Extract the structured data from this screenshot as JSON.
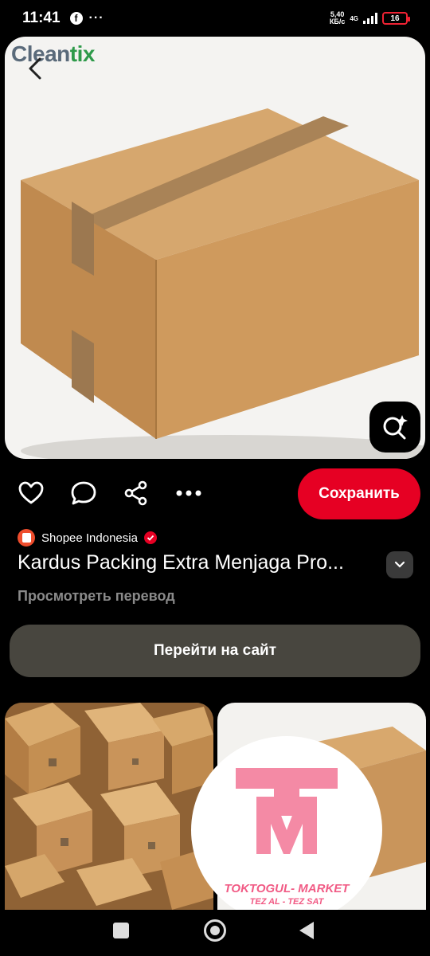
{
  "status_bar": {
    "time": "11:41",
    "more": "···",
    "net_speed_top": "5,40",
    "net_speed_unit": "КБ/с",
    "network": "4G",
    "battery": "16"
  },
  "hero": {
    "watermark_prefix": "Clean",
    "watermark_suffix": "tix",
    "accent_color": "#2e9a4a"
  },
  "actions": {
    "save_label": "Сохранить",
    "save_color": "#e60023"
  },
  "pin": {
    "source_name": "Shopee Indonesia",
    "title": "Kardus Packing Extra Menjaga Pro...",
    "translate_label": "Просмотреть перевод",
    "visit_label": "Перейти на сайт"
  },
  "sticker": {
    "line1": "TOKTOGUL- MARKET",
    "line2": "TEZ AL - TEZ SAT",
    "color": "#f15b85"
  }
}
